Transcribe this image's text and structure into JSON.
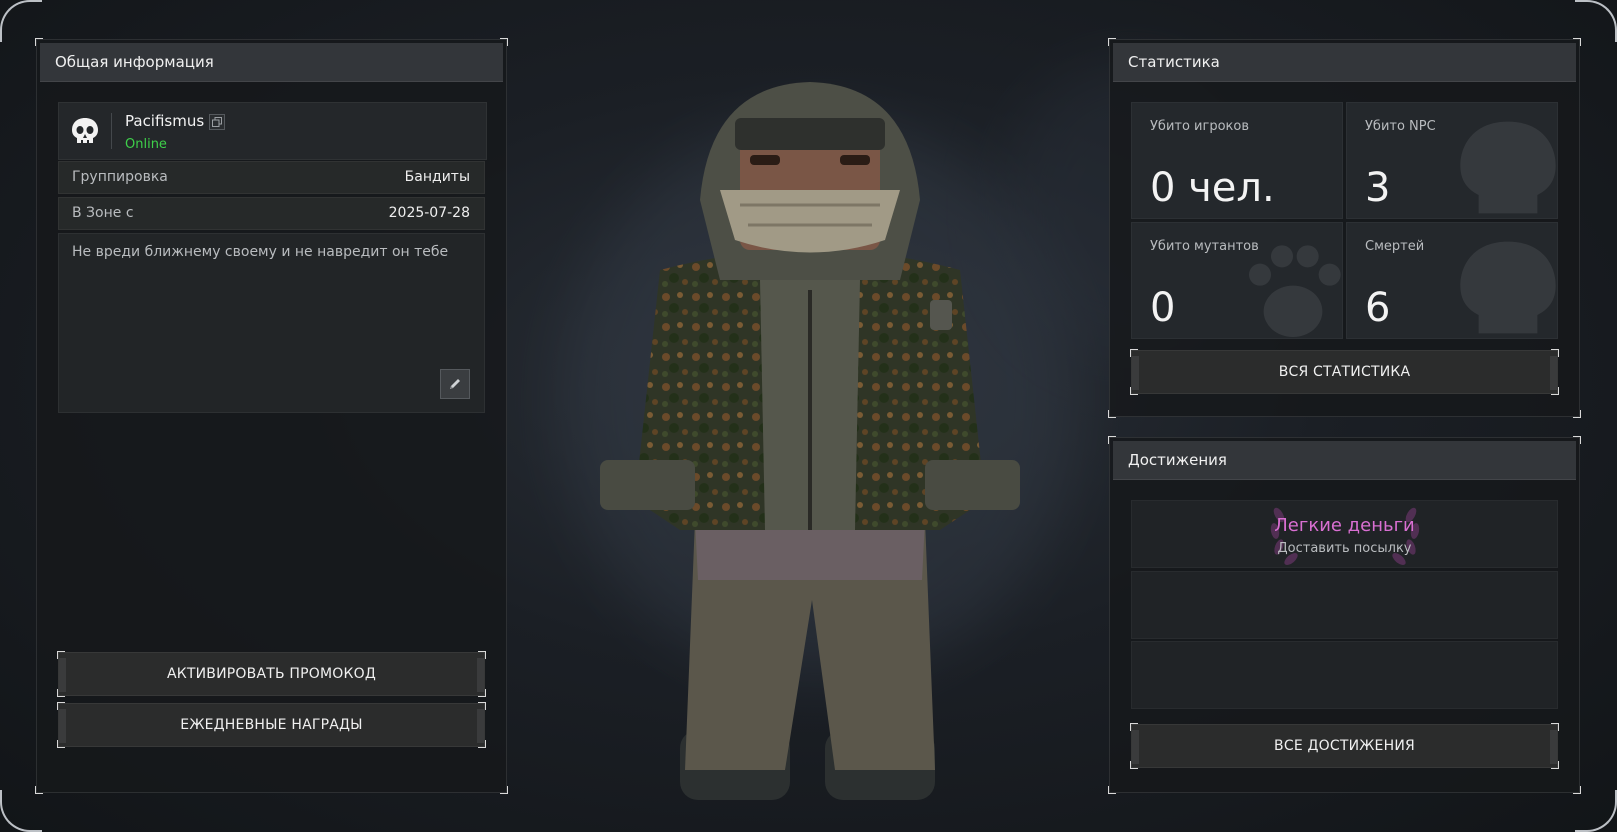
{
  "profile": {
    "panel_title": "Общая информация",
    "name": "Pacifismus",
    "status": "Online",
    "faction_label": "Группировка",
    "faction_value": "Бандиты",
    "zone_label": "В Зоне с",
    "zone_value": "2025-07-28",
    "bio": "Не вреди ближнему своему и не навредит он тебе",
    "promo_button": "АКТИВИРОВАТЬ ПРОМОКОД",
    "daily_button": "ЕЖЕДНЕВНЫЕ НАГРАДЫ"
  },
  "stats": {
    "panel_title": "Статистика",
    "tiles": [
      {
        "label": "Убито игроков",
        "value": "0 чел."
      },
      {
        "label": "Убито NPC",
        "value": "3"
      },
      {
        "label": "Убито мутантов",
        "value": "0"
      },
      {
        "label": "Смертей",
        "value": "6"
      }
    ],
    "all_button": "ВСЯ СТАТИСТИКА"
  },
  "achievements": {
    "panel_title": "Достижения",
    "items": [
      {
        "title": "Легкие деньги",
        "description": "Доставить посылку"
      }
    ],
    "all_button": "ВСЕ ДОСТИЖЕНИЯ"
  },
  "colors": {
    "online": "#3ed04a",
    "achievement_title": "#d96fd2",
    "panel_bg": "#16181b",
    "header_bg": "#33363a"
  },
  "icons": {
    "faction": "skull-icon",
    "copy": "copy-icon",
    "edit": "pencil-icon",
    "achievement": "laurel-wreath-icon"
  }
}
